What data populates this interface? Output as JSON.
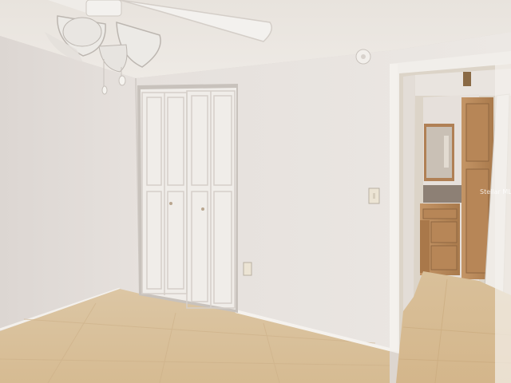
{
  "scene": {
    "description_items": [
      "ceiling-fan",
      "bifold-closet-door",
      "wall-outlet",
      "light-switch",
      "smoke-detector",
      "doorway-to-bathroom",
      "bathroom-vanity",
      "bathroom-mirror",
      "tile-floor"
    ]
  },
  "watermark": {
    "text": "Stellar MLS"
  },
  "colors": {
    "wall": "#e7e2de",
    "wall_shadow": "#d8d2cd",
    "ceiling": "#ebe6e1",
    "floor": "#d8bf98",
    "closet_door": "#f1eeea",
    "trim": "#f2efeb",
    "cabinet": "#b9895a"
  }
}
